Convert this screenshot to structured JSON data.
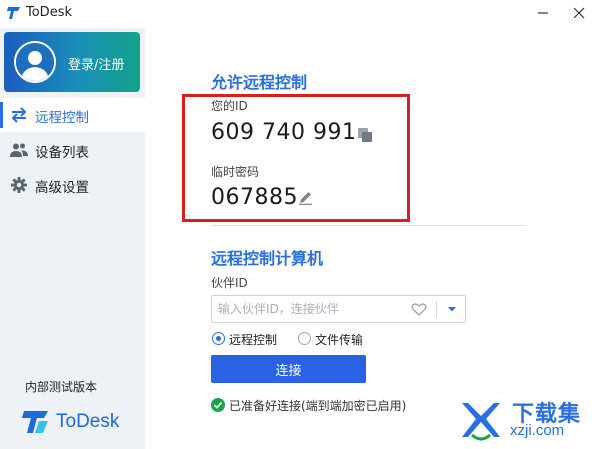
{
  "window": {
    "title": "ToDesk"
  },
  "sidebar": {
    "login_label": "登录/注册",
    "nav": [
      {
        "label": "远程控制",
        "icon": "swap-arrows-icon",
        "active": true
      },
      {
        "label": "设备列表",
        "icon": "users-icon",
        "active": false
      },
      {
        "label": "高级设置",
        "icon": "gear-icon",
        "active": false
      }
    ],
    "beta_label": "内部测试版本",
    "brand": "ToDesk"
  },
  "allow": {
    "title": "允许远程控制",
    "id_label": "您的ID",
    "id_value": "609 740 991",
    "pwd_label": "临时密码",
    "pwd_value": "067885"
  },
  "control": {
    "title": "远程控制计算机",
    "partner_label": "伙伴ID",
    "partner_placeholder": "输入伙伴ID，连接伙伴",
    "partner_value": "",
    "radio_remote": "远程控制",
    "radio_file": "文件传输",
    "selected_mode": "远程控制",
    "connect_label": "连接",
    "status": "已准备好连接(端到端加密已启用)"
  },
  "watermark": {
    "title": "下载集",
    "url": "xzji.com"
  },
  "colors": {
    "accent": "#2a6fe0",
    "highlight": "#d42020",
    "status_ok": "#1aa34a"
  }
}
